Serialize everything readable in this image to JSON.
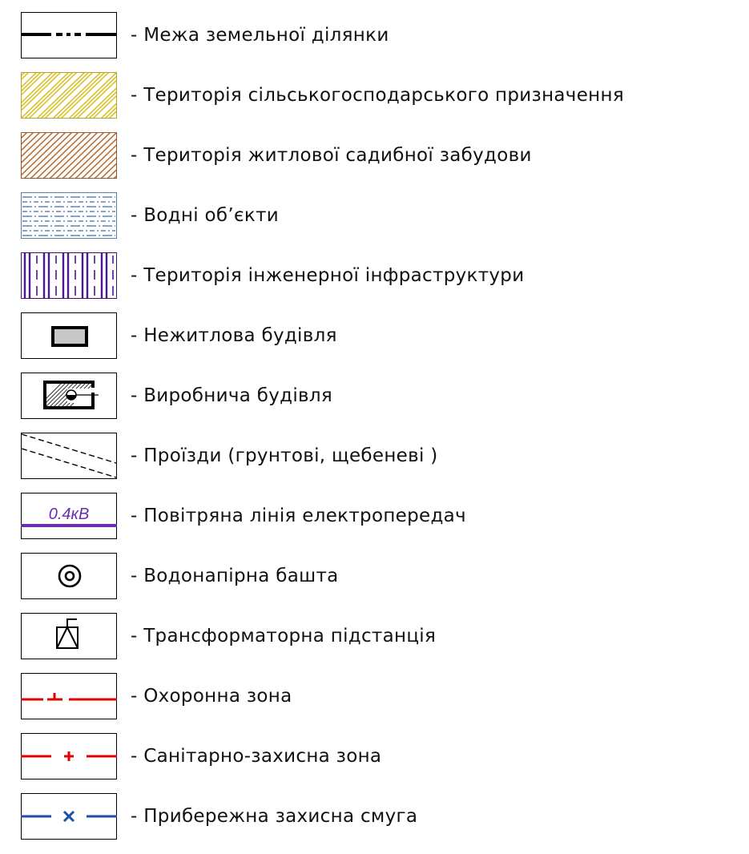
{
  "legend": {
    "items": [
      {
        "id": "boundary",
        "label": "- Межа земельної ділянки",
        "icon": "parcel-boundary-line"
      },
      {
        "id": "agri",
        "label": "- Територія сільськогосподарського призначення",
        "icon": "yellow-hatch",
        "color": "#d8c22a"
      },
      {
        "id": "residential",
        "label": "- Територія житлової садибної забудови",
        "icon": "brown-hatch",
        "color": "#b9713c"
      },
      {
        "id": "water",
        "label": "- Водні об’єкти",
        "icon": "blue-dash-hatch",
        "color": "#3f6ea8"
      },
      {
        "id": "infra",
        "label": "- Територія інженерної інфраструктури",
        "icon": "purple-vertical-hatch",
        "color": "#4a1a8c"
      },
      {
        "id": "nonres",
        "label": "- Нежитлова будівля",
        "icon": "building-rect",
        "color": "#c8c8c8"
      },
      {
        "id": "industrial",
        "label": "- Виробнича будівля",
        "icon": "industrial-building"
      },
      {
        "id": "roads",
        "label": "- Проїзди (грунтові, щебеневі )",
        "icon": "dashed-road"
      },
      {
        "id": "powerline",
        "label": "- Повітряна лінія електропередач",
        "icon": "power-line",
        "voltage": "0.4кВ",
        "color": "#6a2cb0"
      },
      {
        "id": "watertower",
        "label": "- Водонапірна башта",
        "icon": "water-tower-circle"
      },
      {
        "id": "transformer",
        "label": "- Трансформаторна підстанція",
        "icon": "transformer-substation"
      },
      {
        "id": "protect",
        "label": "- Охоронна зона",
        "icon": "red-tick-line",
        "color": "#e00000"
      },
      {
        "id": "sanitary",
        "label": "- Санітарно-захисна зона",
        "icon": "red-plus-line",
        "color": "#e00000"
      },
      {
        "id": "coastal",
        "label": "- Прибережна захисна смуга",
        "icon": "blue-x-line",
        "color": "#1b4fa8"
      }
    ]
  }
}
